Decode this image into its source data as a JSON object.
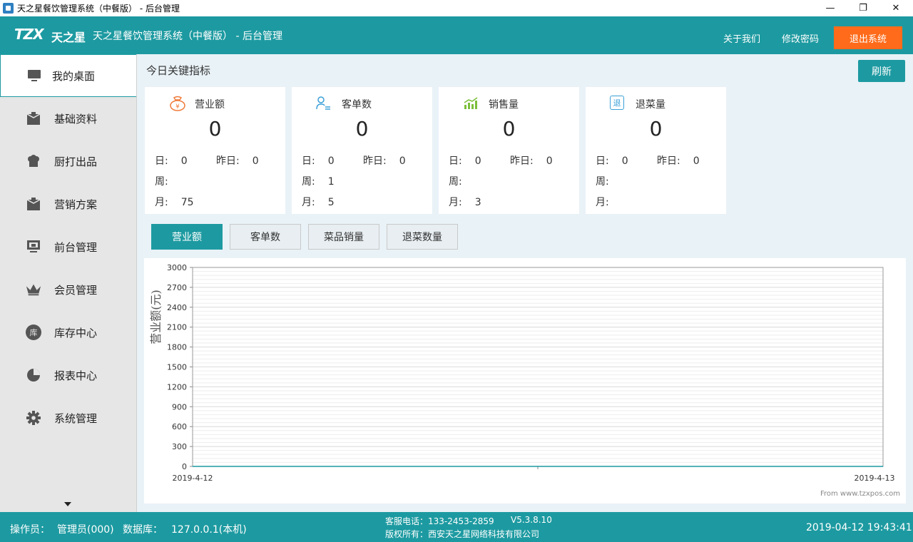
{
  "window": {
    "title": "天之星餐饮管理系统（中餐版） - 后台管理",
    "min_glyph": "—",
    "max_glyph": "❐",
    "close_glyph": "✕"
  },
  "header": {
    "logo_text": "TZX",
    "logo_cn": "天之星",
    "app_title": "天之星餐饮管理系统（中餐版） - 后台管理",
    "about": "关于我们",
    "change_password": "修改密码",
    "logout": "退出系统"
  },
  "sidebar": {
    "items": [
      {
        "label": "我的桌面",
        "icon": "monitor-icon"
      },
      {
        "label": "基础资料",
        "icon": "box-icon"
      },
      {
        "label": "厨打出品",
        "icon": "chef-icon"
      },
      {
        "label": "营销方案",
        "icon": "box-icon"
      },
      {
        "label": "前台管理",
        "icon": "screen-icon"
      },
      {
        "label": "会员管理",
        "icon": "crown-icon"
      },
      {
        "label": "库存中心",
        "icon": "warehouse-icon"
      },
      {
        "label": "报表中心",
        "icon": "pie-chart-icon"
      },
      {
        "label": "系统管理",
        "icon": "gear-icon"
      }
    ],
    "warehouse_glyph": "库"
  },
  "main": {
    "heading": "今日关键指标",
    "refresh": "刷新",
    "day_label": "日:",
    "yesterday_label": "昨日:",
    "week_label": "周:",
    "month_label": "月:",
    "cards": [
      {
        "title": "营业额",
        "icon": "money-bag-icon",
        "value": "0",
        "day": "0",
        "yesterday": "0",
        "week": "",
        "month": "75"
      },
      {
        "title": "客单数",
        "icon": "user-list-icon",
        "value": "0",
        "day": "0",
        "yesterday": "0",
        "week": "1",
        "month": "5"
      },
      {
        "title": "销售量",
        "icon": "trend-chart-icon",
        "value": "0",
        "day": "0",
        "yesterday": "0",
        "week": "",
        "month": "3"
      },
      {
        "title": "退菜量",
        "icon": "return-icon",
        "value": "0",
        "day": "0",
        "yesterday": "0",
        "week": "",
        "month": ""
      }
    ],
    "return_glyph": "退",
    "tabs": [
      "营业额",
      "客单数",
      "菜品销量",
      "退菜数量"
    ],
    "watermark": "From www.tzxpos.com"
  },
  "chart_data": {
    "type": "line",
    "ylabel": "营业额(元)",
    "xlabel": "",
    "x": [
      "2019-4-12",
      "2019-4-13"
    ],
    "series": [
      {
        "values": [
          0,
          0
        ]
      }
    ],
    "ylim": [
      0,
      3000
    ],
    "yticks": [
      0,
      300,
      600,
      900,
      1200,
      1500,
      1800,
      2100,
      2400,
      2700,
      3000
    ],
    "grid": true,
    "colors": {
      "line": "#1d9aa1",
      "grid": "#dddddd"
    }
  },
  "status": {
    "operator_label": "操作员：",
    "operator": "管理员(000)",
    "db_label": "数据库：",
    "db": "127.0.0.1(本机)",
    "hotline": "客服电话：133-2453-2859",
    "version": "V5.3.8.10",
    "copyright": "版权所有：西安天之星网络科技有限公司",
    "datetime": "2019-04-12 19:43:41"
  },
  "colors": {
    "accent": "#1d9aa1",
    "logout": "#ff6b1a"
  }
}
